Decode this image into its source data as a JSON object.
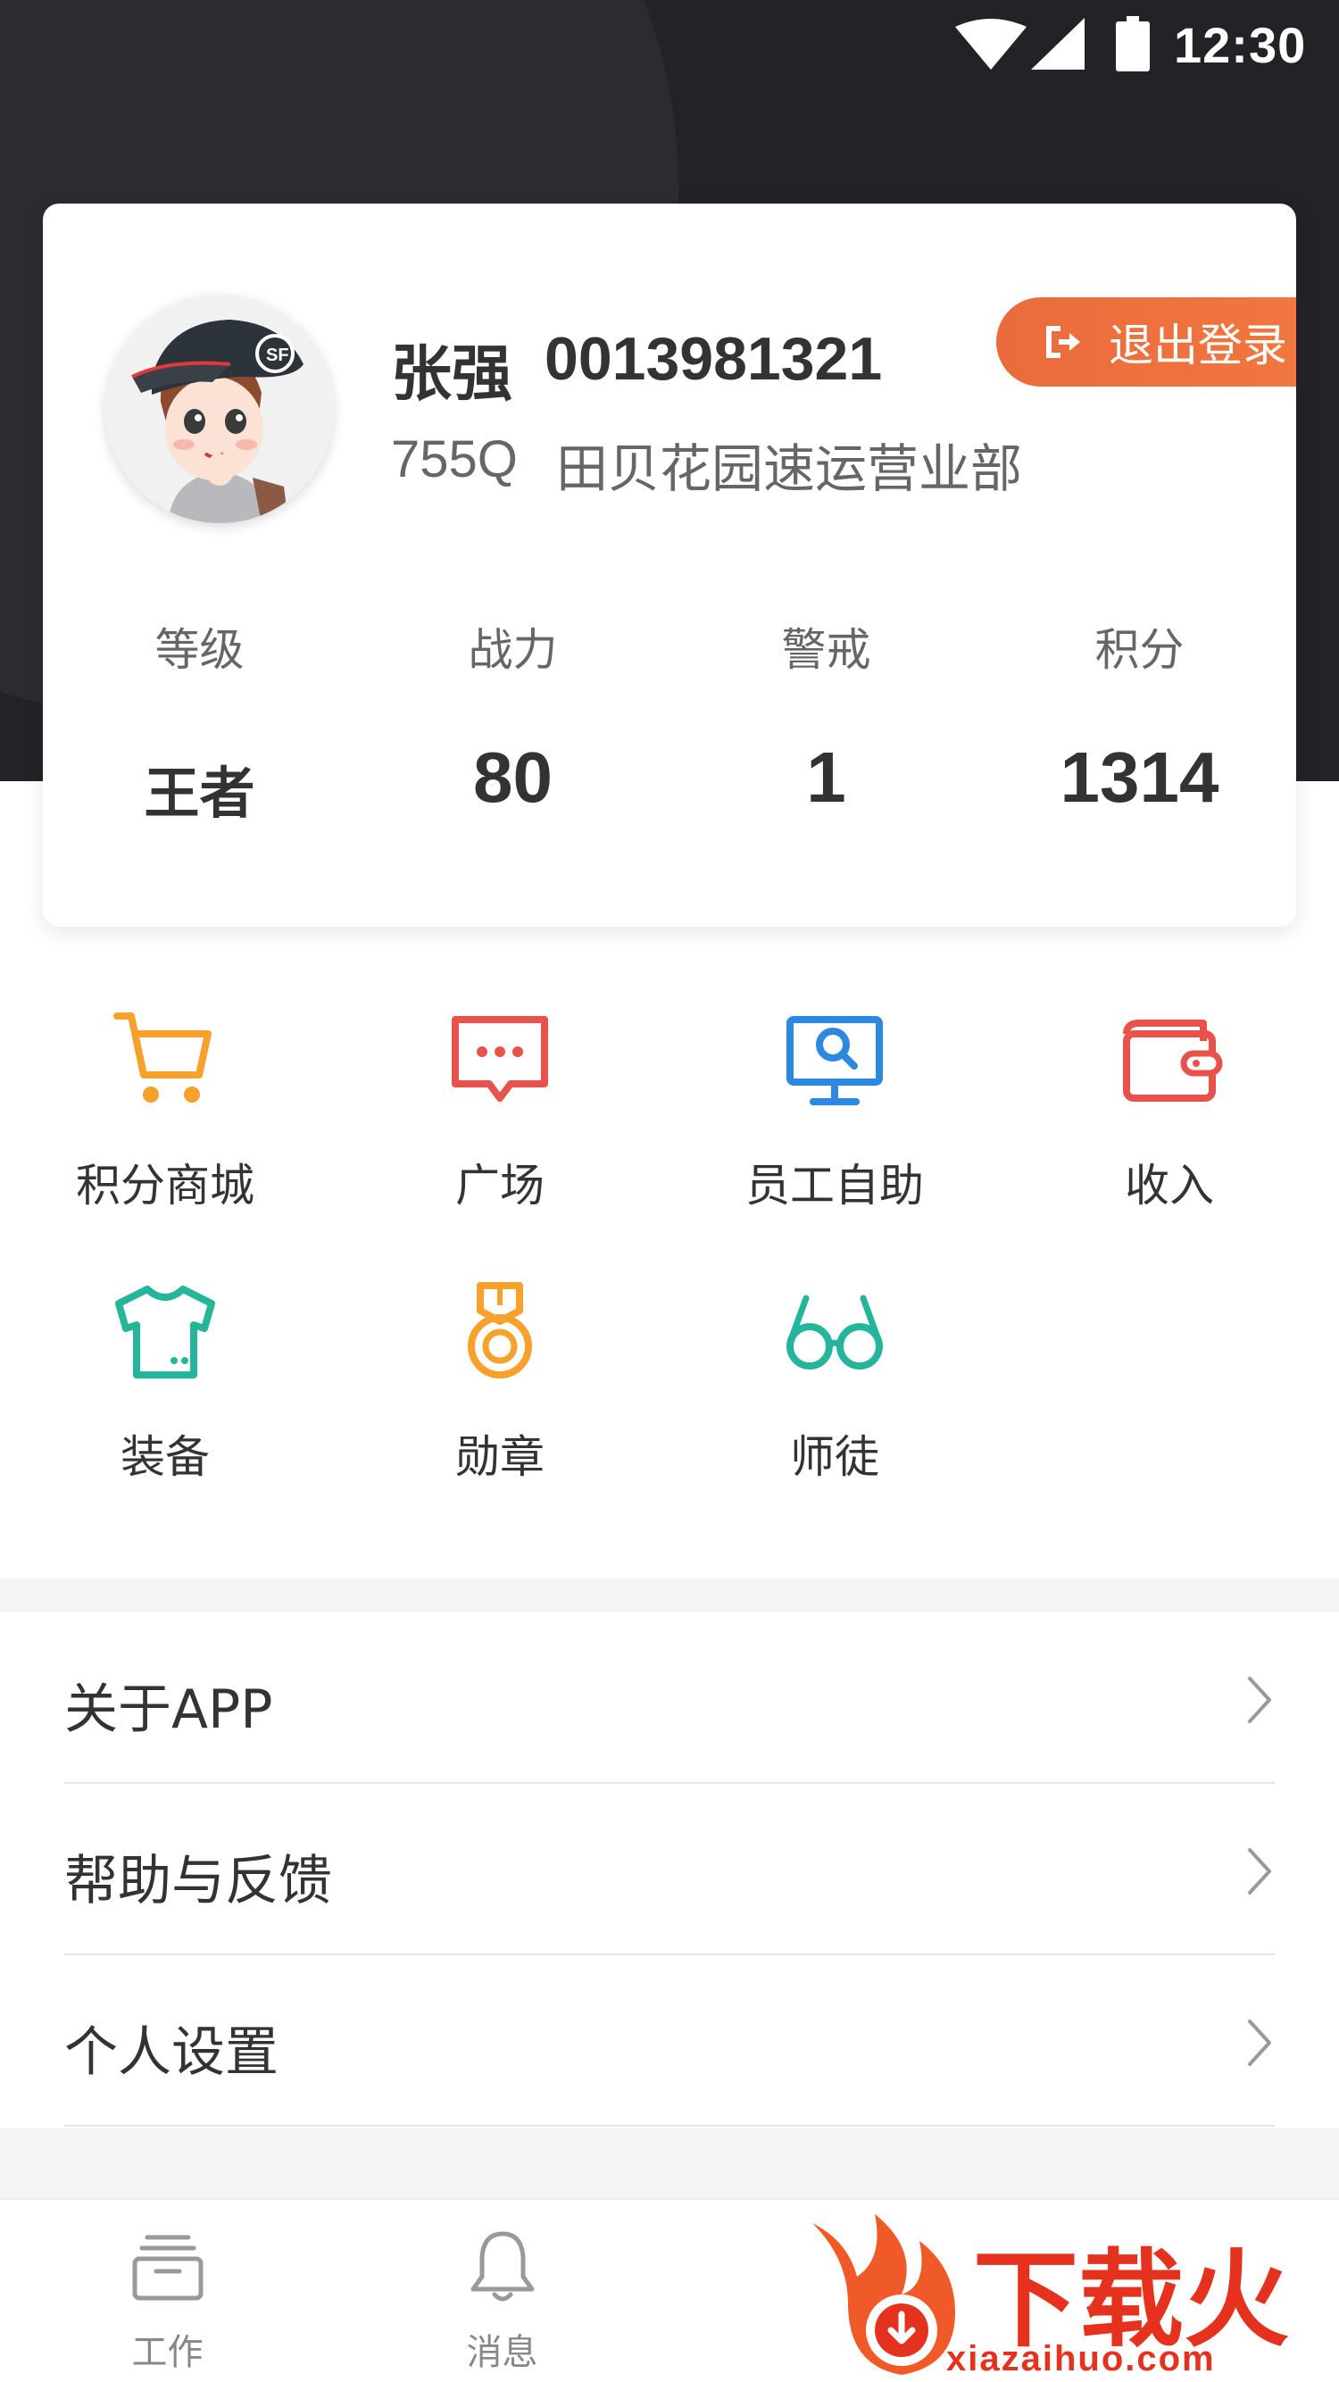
{
  "status_bar": {
    "time": "12:30"
  },
  "profile": {
    "name": "张强",
    "employee_id": "0013981321",
    "dept_code": "755Q",
    "dept_name": "田贝花园速运营业部",
    "logout_label": "退出登录"
  },
  "stats": [
    {
      "label": "等级",
      "value": "王者"
    },
    {
      "label": "战力",
      "value": "80"
    },
    {
      "label": "警戒",
      "value": "1"
    },
    {
      "label": "积分",
      "value": "1314"
    }
  ],
  "grid": [
    {
      "label": "积分商城",
      "icon": "cart-icon",
      "color": "#f5a12c"
    },
    {
      "label": "广场",
      "icon": "chat-bubble-icon",
      "color": "#e9524a"
    },
    {
      "label": "员工自助",
      "icon": "monitor-search-icon",
      "color": "#2d88e0"
    },
    {
      "label": "收入",
      "icon": "wallet-icon",
      "color": "#e9524a"
    },
    {
      "label": "装备",
      "icon": "tshirt-icon",
      "color": "#25b59a"
    },
    {
      "label": "勋章",
      "icon": "medal-icon",
      "color": "#f5a12c"
    },
    {
      "label": "师徒",
      "icon": "glasses-icon",
      "color": "#25b59a"
    }
  ],
  "menu": [
    {
      "label": "关于APP"
    },
    {
      "label": "帮助与反馈"
    },
    {
      "label": "个人设置"
    }
  ],
  "bottom_nav": [
    {
      "label": "工作",
      "icon": "inbox-icon"
    },
    {
      "label": "消息",
      "icon": "bell-icon"
    }
  ],
  "watermark": {
    "text": "下载火",
    "url": "xiazaihuo.com"
  },
  "colors": {
    "header_bg": "#232327",
    "accent": "#ea6b3c"
  }
}
